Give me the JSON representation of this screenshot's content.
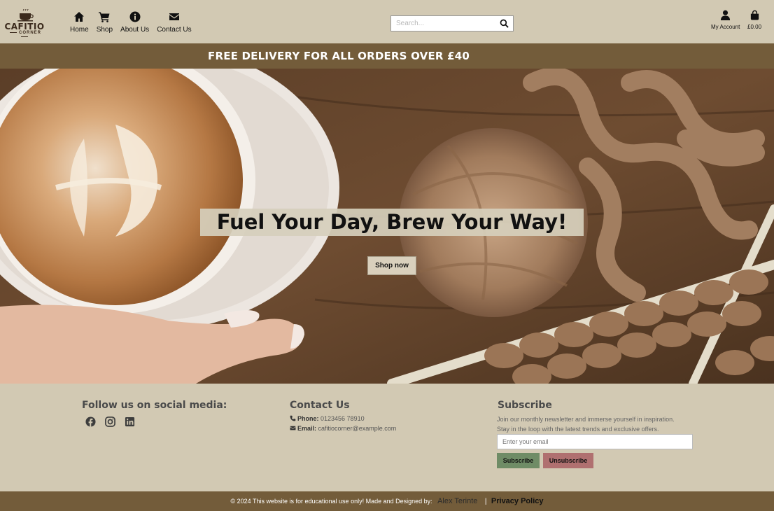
{
  "brand": {
    "name": "CAFITIO",
    "tagline": "CORNER"
  },
  "nav": [
    {
      "label": "Home",
      "icon": "home-icon"
    },
    {
      "label": "Shop",
      "icon": "cart-icon"
    },
    {
      "label": "About Us",
      "icon": "info-icon"
    },
    {
      "label": "Contact Us",
      "icon": "envelope-icon"
    }
  ],
  "search": {
    "placeholder": "Search..."
  },
  "account": {
    "label": "My Account"
  },
  "bag": {
    "total": "£0.00"
  },
  "banner": {
    "text": "FREE DELIVERY FOR ALL ORDERS OVER £40"
  },
  "hero": {
    "title": "Fuel Your Day, Brew Your Way!",
    "button": "Shop now"
  },
  "footer": {
    "social": {
      "title": "Follow us on social media:",
      "icons": [
        "facebook-icon",
        "instagram-icon",
        "linkedin-icon"
      ]
    },
    "contact": {
      "title": "Contact Us",
      "phone_label": "Phone:",
      "phone": "0123456 78910",
      "email_label": "Email:",
      "email": "cafitiocorner@example.com"
    },
    "subscribe": {
      "title": "Subscribe",
      "line1": "Join our monthly newsletter and immerse yourself in inspiration.",
      "line2": "Stay in the loop with the latest trends and exclusive offers.",
      "placeholder": "Enter your email",
      "subscribe_label": "Subscribe",
      "unsubscribe_label": "Unsubscribe"
    }
  },
  "bottom": {
    "copyright": "© 2024 This website is for educational use only! Made and Designed by:",
    "author": "Alex Terinte",
    "separator": "|",
    "privacy": "Privacy Policy"
  },
  "colors": {
    "background": "#d2c9b3",
    "accent": "#735c3a",
    "subscribe": "#6f8c66",
    "unsubscribe": "#b07070"
  }
}
